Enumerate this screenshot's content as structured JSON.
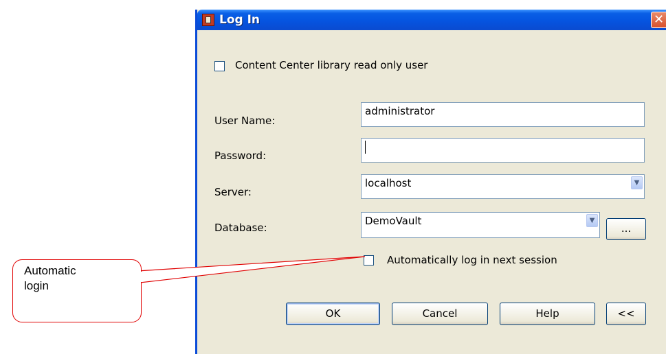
{
  "dialog": {
    "title": "Log In",
    "close_symbol": "✕",
    "readonly_checkbox_label": "Content Center library read only user",
    "username": {
      "label": "User Name:",
      "value": "administrator"
    },
    "password": {
      "label": "Password:",
      "value": ""
    },
    "server": {
      "label": "Server:",
      "value": "localhost"
    },
    "database": {
      "label": "Database:",
      "value": "DemoVault",
      "browse_label": "..."
    },
    "auto_login_label": "Automatically log in next session",
    "buttons": {
      "ok": "OK",
      "cancel": "Cancel",
      "help": "Help",
      "collapse": "<<"
    }
  },
  "callout": {
    "text": "Automatic\nlogin",
    "color": "#e00000"
  },
  "colors": {
    "titlebar": "#0554e0",
    "dialog_bg": "#ece9d8",
    "field_border": "#7f9db9"
  },
  "icons": [
    "app-icon",
    "close-icon",
    "chevron-down-icon"
  ]
}
